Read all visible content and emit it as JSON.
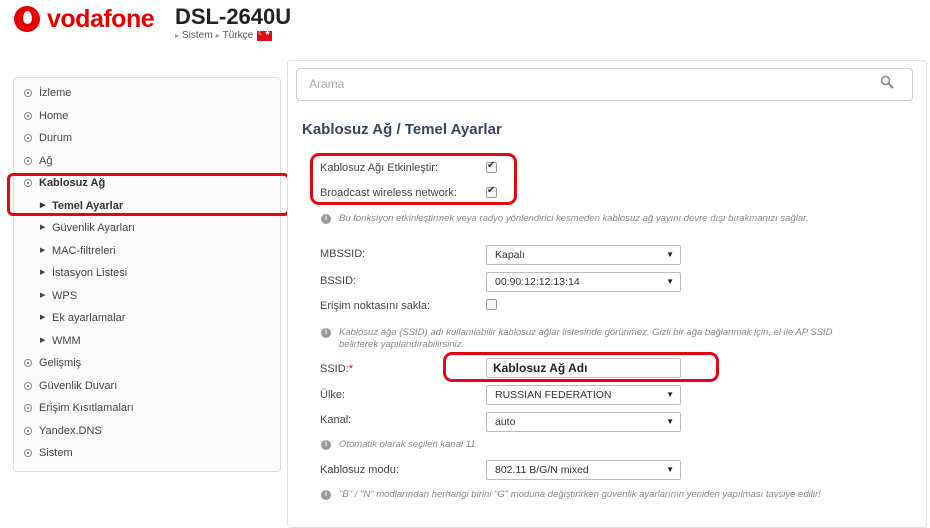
{
  "header": {
    "brand": "vodafone",
    "model": "DSL-2640U",
    "nav_system": "Sistem",
    "nav_language": "Türkçe"
  },
  "sidebar": {
    "items": [
      {
        "label": "İzleme"
      },
      {
        "label": "Home"
      },
      {
        "label": "Durum"
      },
      {
        "label": "Ağ"
      },
      {
        "label": "Kablosuz Ağ"
      },
      {
        "label": "Temel Ayarlar"
      },
      {
        "label": "Güvenlik Ayarları"
      },
      {
        "label": "MAC-filtreleri"
      },
      {
        "label": "İstasyon Listesi"
      },
      {
        "label": "WPS"
      },
      {
        "label": "Ek ayarlamalar"
      },
      {
        "label": "WMM"
      },
      {
        "label": "Gelişmiş"
      },
      {
        "label": "Güvenlik Duvarı"
      },
      {
        "label": "Erişim Kısıtlamaları"
      },
      {
        "label": "Yandex.DNS"
      },
      {
        "label": "Sistem"
      }
    ]
  },
  "search": {
    "placeholder": "Arama"
  },
  "page": {
    "title": "Kablosuz Ağ /  Temel Ayarlar",
    "enable_wireless_label": "Kablosuz Ağı Etkinleştir:",
    "enable_wireless_checked": true,
    "broadcast_label": "Broadcast wireless network:",
    "broadcast_checked": true,
    "hint_enable": "Bu fonksiyon etkinleştirmek veya radyo yönlendirici kesmeden kablosuz ağ yayını devre dışı bırakmanızı sağlar.",
    "mbssid_label": "MBSSID:",
    "mbssid_value": "Kapalı",
    "bssid_label": "BSSID:",
    "bssid_value": "00:90:12:12:13:14",
    "hide_ap_label": "Erişim noktasını sakla:",
    "hide_ap_checked": false,
    "hint_ssid": "Kablosuz ağa (SSID) adı kullanılabilir kablosuz ağlar listesinde görünmez. Gizli bir ağa bağlanmak için, el ile AP SSID belirterek yapılandırabilirsiniz.",
    "ssid_label": "SSID:",
    "ssid_required": "*",
    "ssid_value": "Kablosuz Ağ Adı",
    "country_label": "Ülke:",
    "country_value": "RUSSIAN FEDERATION",
    "channel_label": "Kanal:",
    "channel_value": "auto",
    "hint_channel": "Otomatik olarak seçilen kanal 11",
    "mode_label": "Kablosuz modu:",
    "mode_value": "802.11 B/G/N mixed",
    "hint_mode": "\"B\" / \"N\" modlarından herhangi birini \"G\" moduna değiştirirken güvenlik ayarlarının yeniden yapılması tavsiye edilir!"
  },
  "colors": {
    "brand_red": "#e60000",
    "highlight_red": "#e30613",
    "title_blue": "#33495f"
  }
}
